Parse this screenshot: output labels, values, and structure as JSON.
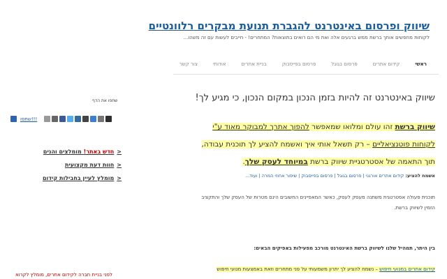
{
  "header": {
    "title": "שיווק ופרסום באינטרנט להגברת תנועת מבקרים רלוונטיים",
    "tagline": "לקוחות מחפשים אותך ברשת ממש ברגעים אלה ואת מי הם רואים בתוצאות? המתחרים! - חייבים לעשות עם זה משהו..."
  },
  "nav": {
    "items": [
      "ראשי",
      "קידום אתרים",
      "פרסום בגוגל",
      "פרסום בפייסבוק",
      "בניית אתרים",
      "אודותי",
      "צור קשר"
    ]
  },
  "main": {
    "headline": "שיווק באינטרנט זה להיות בזמן הנכון במקום הנכון, כי מגיע לך!",
    "intro": {
      "lead": "שיווק ברשת",
      "part1": " זהו עולם ומלואו שמאפשר ",
      "underline1": "להפוך אתרך למבוקר מאוד ע\"י לקוחות פוטנציאליים",
      "part2": " – רק תשאל אותי איך ואשמח להציע לך תוכנית עבודה, תוך התאמה של אסטרטגיית שיווק ברשת ",
      "underline2": "במיוחד לעסק שלך"
    },
    "tags_label": "אשמח להציע:",
    "tags": "קידום אתרים אורגני | פרסום בגוגל | פרסום בפייסבוק | שיפור אחוזי המרה | ועוד...",
    "para1": "תוכנית פעולה אסטרטגית משתנה מעסק לעסק, כאשר המאפיינים החשובים הינם מטרות של העסק שלך והתקציב הזמין לשיווק ברשת.",
    "para2": "בין היתר, תמהיל שלנו לשיווק ברשת האינטרנט מורכב מפעילות באפיקים הבאים:",
    "para3_link": "קידום אתרים במנועי חיפוש",
    "para3_rest": " – נשמח להציע לך יתרון משמעותי על פני מתחרים וזאת באמצעות מנועי חיפוש"
  },
  "sidebar": {
    "share_title": "שתפו את הדף",
    "share_label": "שתפו!!!",
    "share_icons": [
      "facebook-icon",
      "twitter-icon",
      "google-plus-icon",
      "linkedin-icon",
      "digg-icon",
      "delicious-icon",
      "email-icon",
      "print-icon",
      "plus-icon"
    ],
    "links": [
      {
        "label": "חדש באתר! מומלצים והנים",
        "red": "חדש באתר!"
      },
      {
        "label": "חוות דעת מקצועית",
        "red": ""
      },
      {
        "label": "מומלץ לעיין בחבילות קידום",
        "red": ""
      }
    ],
    "bottom": "לפני בניית חברה לקידום אתרים, מומלץ לקרוא"
  },
  "colors": {
    "link": "#1c5b9a",
    "highlight": "#ffffa8",
    "red": "#c00000"
  }
}
